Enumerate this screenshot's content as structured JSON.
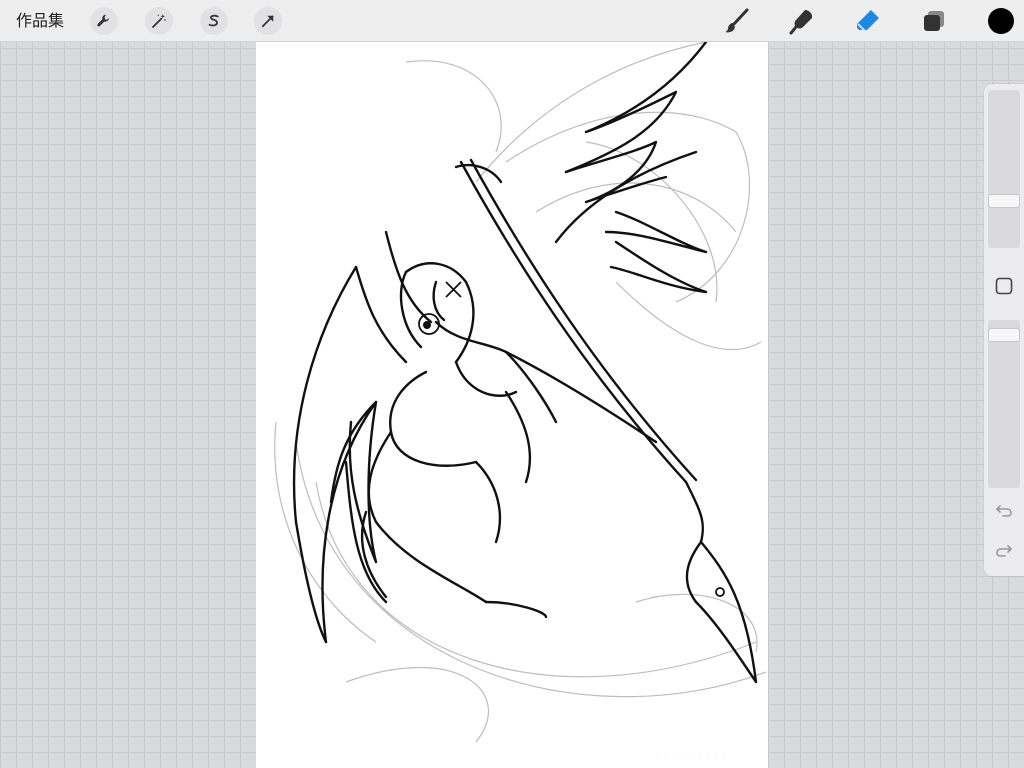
{
  "topbar": {
    "gallery_label": "作品集",
    "left_tools": [
      "wrench-icon",
      "magic-wand-icon",
      "selection-s-icon",
      "transform-arrow-icon"
    ],
    "right_tools": [
      "brush-icon",
      "smudge-icon",
      "eraser-icon",
      "layers-icon"
    ],
    "active_tool": "eraser-icon",
    "current_color": "#000000",
    "accent": "#1e88e5"
  },
  "sidebar": {
    "controls": [
      "brush-size-slider",
      "modify-square-button",
      "opacity-slider",
      "undo-icon",
      "redo-icon"
    ]
  },
  "canvas": {
    "background": "#ffffff",
    "content": "line-art-drawing"
  }
}
